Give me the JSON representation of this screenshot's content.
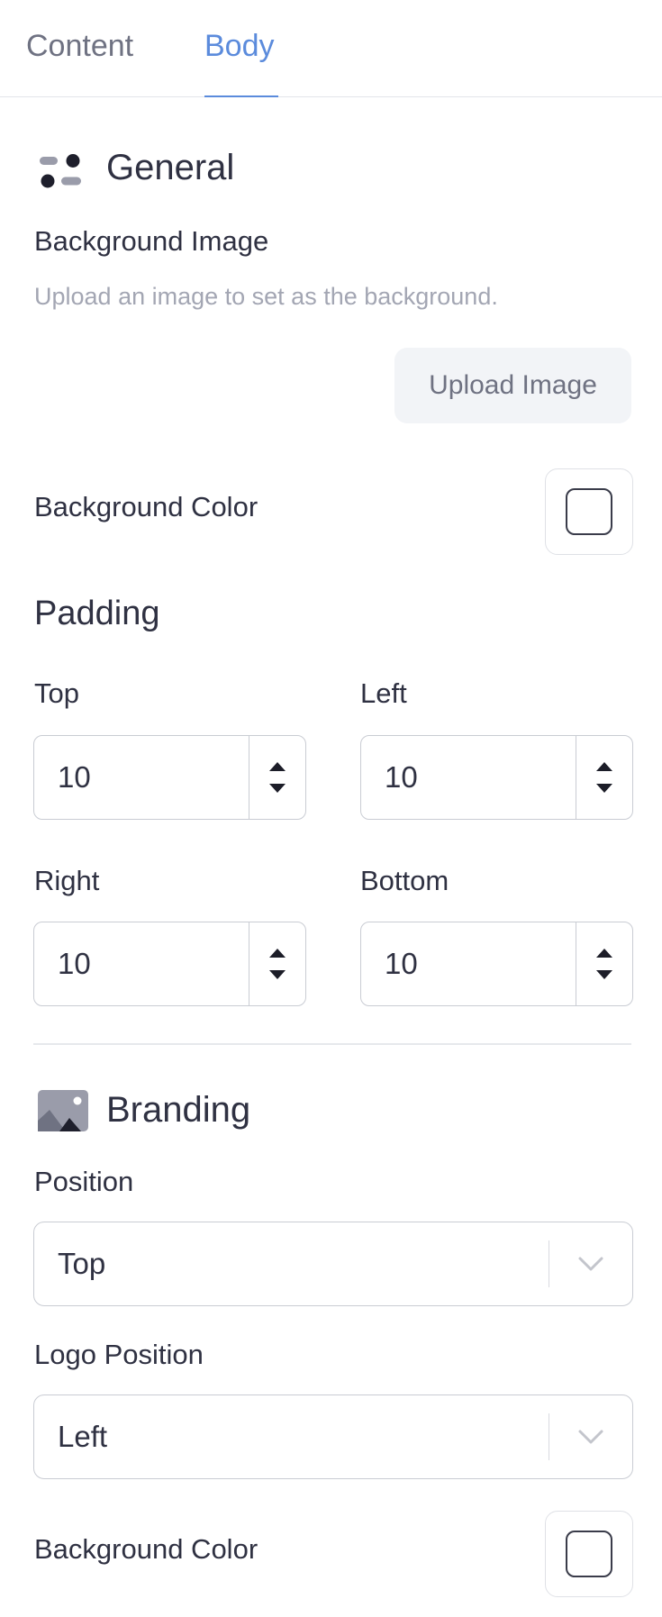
{
  "tabs": [
    {
      "label": "Content",
      "active": false
    },
    {
      "label": "Body",
      "active": true
    }
  ],
  "general": {
    "title": "General",
    "icon": "general-settings-icon",
    "background_image": {
      "label": "Background Image",
      "description": "Upload an image to set as the background.",
      "button_label": "Upload Image"
    },
    "background_color": {
      "label": "Background Color",
      "value": "#ffffff"
    }
  },
  "padding": {
    "title": "Padding",
    "fields": [
      {
        "label": "Top",
        "value": "10"
      },
      {
        "label": "Left",
        "value": "10"
      },
      {
        "label": "Right",
        "value": "10"
      },
      {
        "label": "Bottom",
        "value": "10"
      }
    ]
  },
  "branding": {
    "title": "Branding",
    "icon": "image-icon",
    "position": {
      "label": "Position",
      "selected": "Top"
    },
    "logo_position": {
      "label": "Logo Position",
      "selected": "Left"
    },
    "background_color": {
      "label": "Background Color",
      "value": "#ffffff"
    }
  },
  "colors": {
    "accent": "#5b8bdc",
    "text": "#2f3142",
    "muted": "#a3a6b3",
    "border": "#c9ccd3",
    "button_bg": "#f2f4f7"
  }
}
